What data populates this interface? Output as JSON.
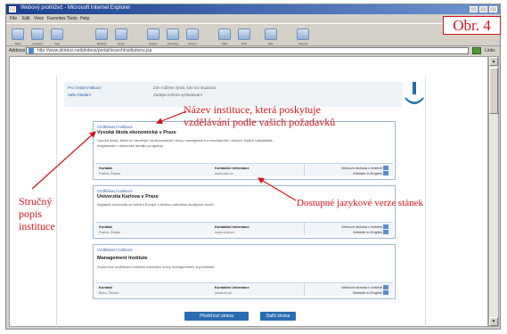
{
  "window": {
    "title": "Webový prohlížeč - Microsoft Internet Explorer"
  },
  "menu": [
    "File",
    "Edit",
    "View",
    "Favorites",
    "Tools",
    "Help"
  ],
  "toolbar": [
    "Back",
    "Forward",
    "Stop",
    "Refresh",
    "Home",
    "Search",
    "Favorites",
    "History",
    "Mail",
    "Print",
    "Edit",
    "Discuss"
  ],
  "address": {
    "label": "Address",
    "value": "http://www.ploteus.net/ploteus/portal/searchInstitutions.jsp",
    "links": "Links"
  },
  "page": {
    "header_links": [
      "Pro české instituce",
      "Vaše hledání"
    ],
    "header_desc": [
      "Zde můžete zjistit, kde lze studovat",
      "Zadejte kritéria vyhledávání"
    ],
    "cards": [
      {
        "type": "Vzdělávací instituce",
        "name": "Vysoká škola ekonomická v Praze",
        "desc": "Vysoká škola, která se zaměřuje na ekonomické obory, management a mezinárodní obchod. Nabízí bakalářské, magisterské i doktorské studijní programy.",
        "col1_h": "Kontakt",
        "col1_v": "Praha, Česko",
        "col2_h": "Kontaktní informace",
        "col2_v": "www.vse.cz",
        "lang1": "Webová stránka v češtině",
        "lang2": "Website in English"
      },
      {
        "type": "Vzdělávací instituce",
        "name": "Univerzita Karlova v Praze",
        "desc": "Nejstarší univerzita ve střední Evropě s širokou nabídkou studijních oborů.",
        "col1_h": "Kontakt",
        "col1_v": "Praha, Česko",
        "col2_h": "Kontaktní informace",
        "col2_v": "www.cuni.cz",
        "lang1": "Webová stránka v češtině",
        "lang2": "Website in English"
      },
      {
        "type": "Vzdělávací instituce",
        "name": "Management Institute",
        "desc": "Soukromá vzdělávací instituce nabízející kurzy managementu a podnikání.",
        "col1_h": "Kontakt",
        "col1_v": "Brno, Česko",
        "col2_h": "Kontaktní informace",
        "col2_v": "www.mi.cz",
        "lang1": "Webová stránka v češtině",
        "lang2": "Website in English"
      }
    ],
    "footer_buttons": [
      "Předchozí strana",
      "Další strana"
    ]
  },
  "annotations": {
    "figure_label": "Obr. 4",
    "institution_name_line1": "Název instituce, která poskytuje",
    "institution_name_line2": "vzdělávání podle vašich požadavků",
    "short_desc_line1": "Stručný",
    "short_desc_line2": "popis",
    "short_desc_line3": "instituce",
    "language_versions": "Dostupné jazykové verze stánek"
  }
}
